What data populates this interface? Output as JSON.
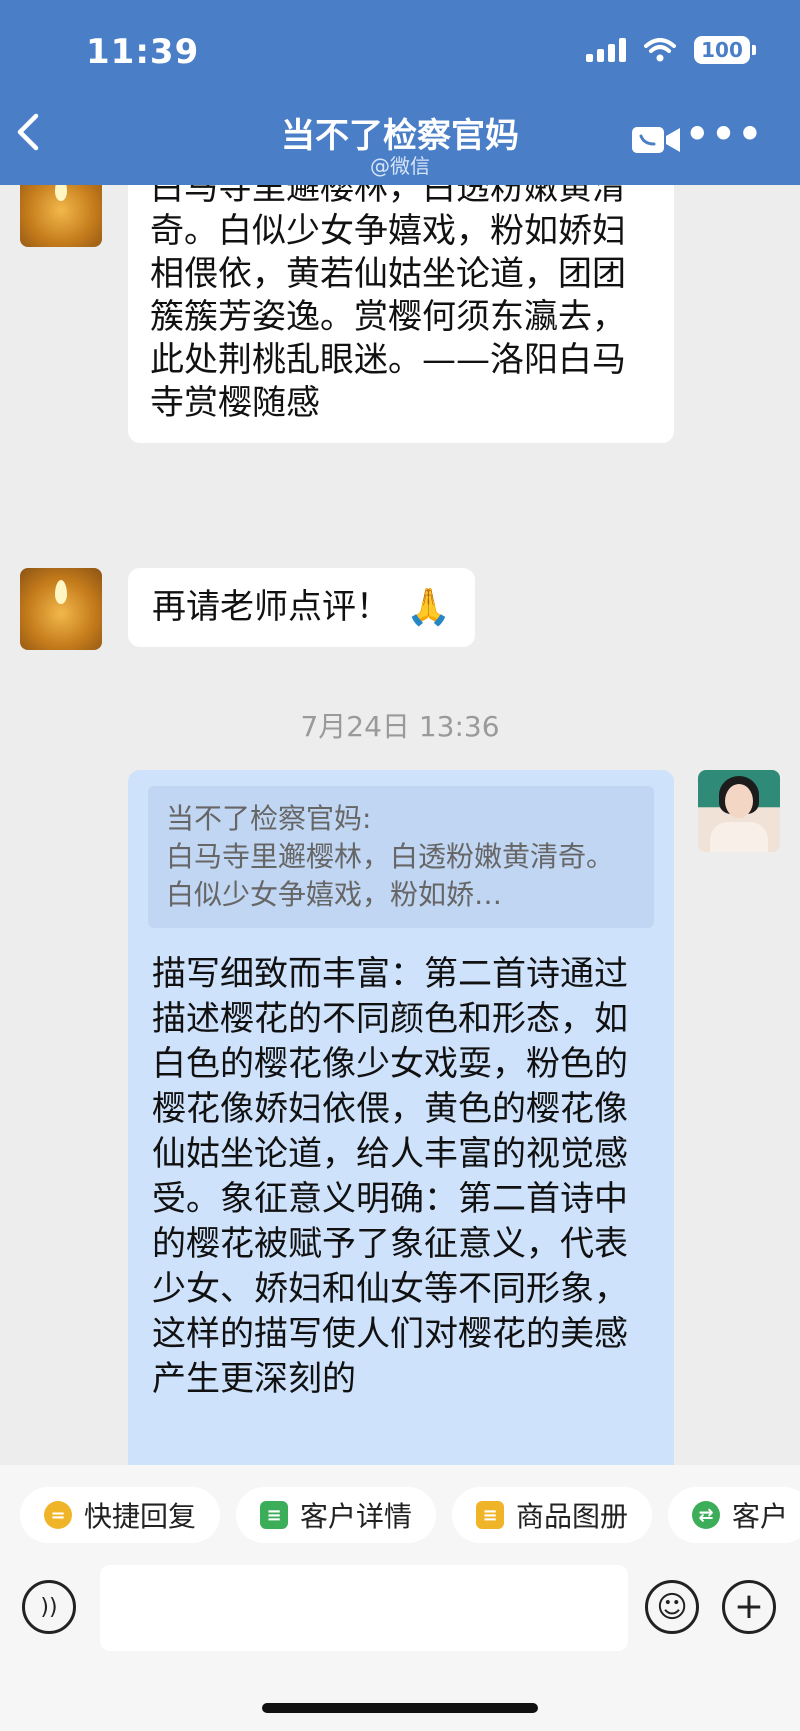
{
  "status_bar": {
    "time": "11:39",
    "battery": "100"
  },
  "header": {
    "title": "当不了检察官妈",
    "subtitle": "@微信",
    "back_icon": "chevron-left-icon",
    "video_icon": "video-camera-icon",
    "more_icon": "more-dots-icon"
  },
  "messages": {
    "poem_text": "白马寺里邂樱林，白透粉嫩黄清奇。白似少女争嬉戏，粉如娇妇相偎依，黄若仙姑坐论道，团团簇簇芳姿逸。赏樱何须东瀛去，此处荆桃乱眼迷。——洛阳白马寺赏樱随感",
    "request_text": "再请老师点评！",
    "request_emoji": "🙏",
    "timestamp": "7月24日 13:36",
    "quote_name": "当不了检察官妈:",
    "quote_text": "白马寺里邂樱林，白透粉嫩黄清奇。白似少女争嬉戏，粉如娇…",
    "reply_text": "描写细致而丰富：第二首诗通过描述樱花的不同颜色和形态，如白色的樱花像少女戏耍，粉色的樱花像娇妇依偎，黄色的樱花像仙姑坐论道，给人丰富的视觉感受。象征意义明确：第二首诗中的樱花被赋予了象征意义，代表少女、娇妇和仙女等不同形象，这样的描写使人们对樱花的美感产生更深刻的"
  },
  "quick_actions": [
    {
      "label": "快捷回复",
      "icon": "quick-reply-icon",
      "color": "#f0b429"
    },
    {
      "label": "客户详情",
      "icon": "customer-icon",
      "color": "#3cae5a"
    },
    {
      "label": "商品图册",
      "icon": "catalog-icon",
      "color": "#f0b429"
    },
    {
      "label": "客户",
      "icon": "customer-transfer-icon",
      "color": "#3cae5a"
    }
  ],
  "input": {
    "placeholder": "",
    "voice_icon": "voice-icon",
    "emoji_icon": "emoji-icon",
    "plus_icon": "plus-icon"
  }
}
